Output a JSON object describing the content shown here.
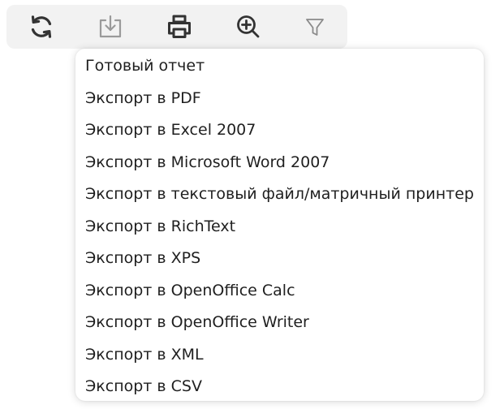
{
  "toolbar": {
    "buttons": [
      {
        "icon": "refresh-icon"
      },
      {
        "icon": "download-icon"
      },
      {
        "icon": "print-icon"
      },
      {
        "icon": "zoom-in-icon"
      },
      {
        "icon": "filter-icon"
      }
    ]
  },
  "menu": {
    "items": [
      "Готовый отчет",
      "Экспорт в PDF",
      "Экспорт в Excel 2007",
      "Экспорт в Microsoft Word 2007",
      "Экспорт в текстовый файл/матричный принтер",
      "Экспорт в RichText",
      "Экспорт в XPS",
      "Экспорт в OpenOffice Calc",
      "Экспорт в OpenOffice Writer",
      "Экспорт в XML",
      "Экспорт в CSV"
    ]
  },
  "colors": {
    "toolbar_bg": "#f2f2f2",
    "icon_dark": "#333333",
    "icon_muted": "#9a9a9a",
    "text": "#1f1f1f"
  }
}
